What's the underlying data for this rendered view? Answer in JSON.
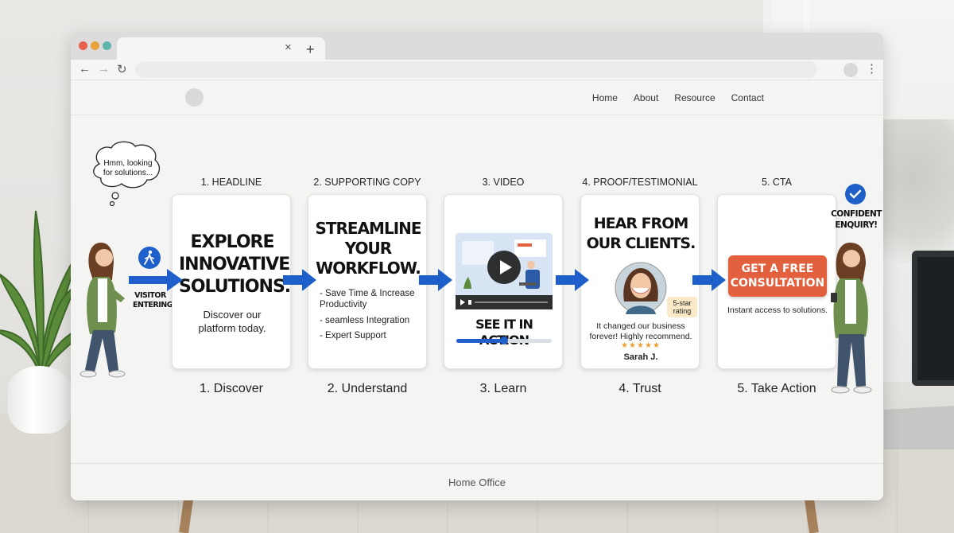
{
  "browser": {
    "tab_close": "×",
    "new_tab": "+",
    "back": "←",
    "forward": "→",
    "reload": "↻",
    "menu": "⋮"
  },
  "site": {
    "nav": [
      "Home",
      "About",
      "Resource",
      "Contact"
    ],
    "footer": "Home Office"
  },
  "visitor": {
    "thought": "Hmm, looking for solutions...",
    "label": "VISITOR ENTERING"
  },
  "customer": {
    "label": "CONFIDENT ENQUIRY!"
  },
  "steps": [
    {
      "header": "1. HEADLINE",
      "label": "1. Discover",
      "title": "EXPLORE INNOVATIVE SOLUTIONS.",
      "body": "Discover our platform today."
    },
    {
      "header": "2. SUPPORTING COPY",
      "label": "2. Understand",
      "title": "STREAMLINE YOUR WORKFLOW.",
      "bullets": [
        "- Save Time & Increase Productivity",
        "- seamless Integration",
        "- Expert Support"
      ]
    },
    {
      "header": "3. VIDEO",
      "label": "3. Learn",
      "title": "SEE IT IN ACTION",
      "progress": 0.5
    },
    {
      "header": "4. PROOF/TESTIMONIAL",
      "label": "4. Trust",
      "title": "HEAR FROM OUR CLIENTS.",
      "badge": "5-star rating",
      "quote": "It changed our business forever! Highly recommend.",
      "stars": "★★★★★",
      "author": "Sarah J."
    },
    {
      "header": "5. CTA",
      "label": "5. Take Action",
      "button": "GET A FREE CONSULTATION",
      "note": "Instant access to solutions."
    }
  ],
  "colors": {
    "arrow": "#1f5fc9",
    "cta": "#e2603d",
    "stars": "#f0a030"
  }
}
